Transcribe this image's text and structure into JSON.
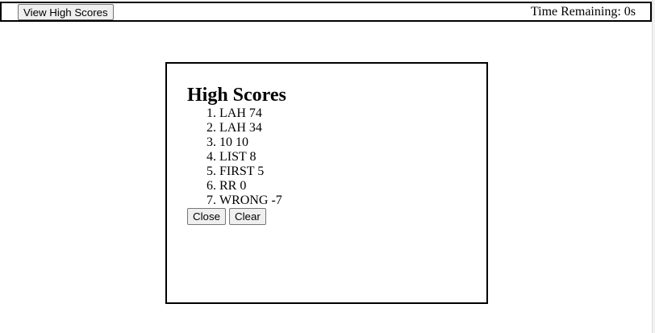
{
  "header": {
    "view_high_scores_label": "View High Scores",
    "timer_label": "Time Remaining:",
    "timer_value": "0s"
  },
  "modal": {
    "title": "High Scores",
    "scores": [
      {
        "name": "LAH",
        "score": "74"
      },
      {
        "name": "LAH",
        "score": "34"
      },
      {
        "name": "10",
        "score": "10"
      },
      {
        "name": "LIST",
        "score": "8"
      },
      {
        "name": "FIRST",
        "score": "5"
      },
      {
        "name": "RR",
        "score": "0"
      },
      {
        "name": "WRONG",
        "score": "-7"
      }
    ],
    "close_label": "Close",
    "clear_label": "Clear"
  }
}
